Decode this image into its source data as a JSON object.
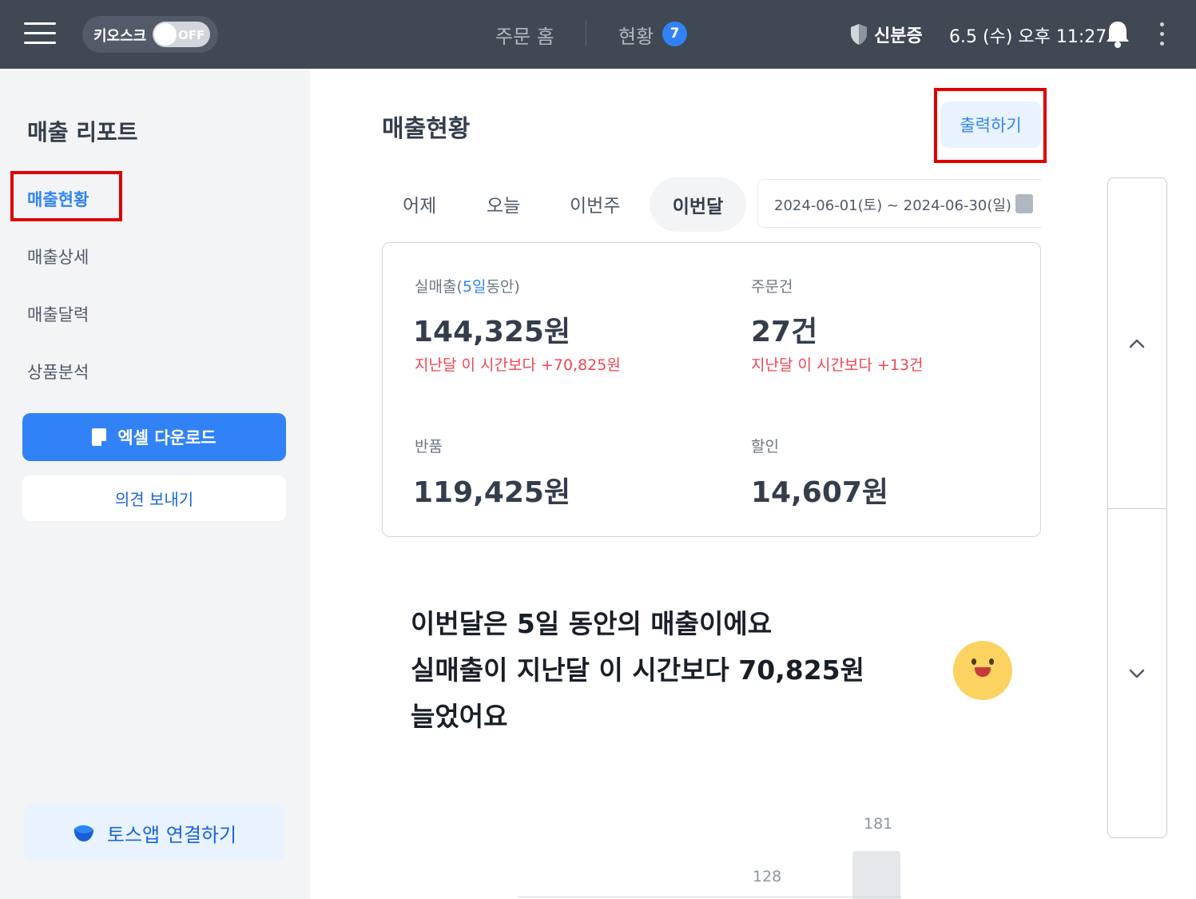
{
  "topbar": {
    "kiosk_label": "키오스크",
    "kiosk_toggle": "OFF",
    "nav_home": "주문 홈",
    "nav_status": "현황",
    "status_badge": "7",
    "id_label": "신분증",
    "datetime": "6.5 (수) 오후 11:27"
  },
  "sidebar": {
    "title": "매출 리포트",
    "items": [
      {
        "label": "매출현황",
        "active": true
      },
      {
        "label": "매출상세",
        "active": false
      },
      {
        "label": "매출달력",
        "active": false
      },
      {
        "label": "상품분석",
        "active": false
      }
    ],
    "excel_button": "엑셀 다운로드",
    "feedback_button": "의견 보내기",
    "toss_button": "토스앱 연결하기"
  },
  "main": {
    "title": "매출현황",
    "print_button": "출력하기",
    "tabs": [
      "어제",
      "오늘",
      "이번주",
      "이번달"
    ],
    "active_tab": "이번달",
    "date_range": "2024-06-01(토) ~ 2024-06-30(일)",
    "stats": {
      "net_sales_label_prefix": "실매출(",
      "net_sales_label_highlight": "5일",
      "net_sales_label_suffix": "동안)",
      "net_sales_value": "144,325원",
      "net_sales_delta": "지난달 이 시간보다 +70,825원",
      "orders_label": "주문건",
      "orders_value": "27건",
      "orders_delta": "지난달 이 시간보다 +13건",
      "returns_label": "반품",
      "returns_value": "119,425원",
      "discount_label": "할인",
      "discount_value": "14,607원"
    },
    "summary": {
      "line1": "이번달은 5일 동안의 매출이에요",
      "line2": "실매출이 지난달 이 시간보다 70,825원",
      "line3": "늘었어요"
    },
    "chart_labels": {
      "left": "128",
      "right": "181"
    }
  },
  "colors": {
    "topbar": "#3f4853",
    "accent": "#3182f6",
    "increase": "#f04452",
    "sidebar_bg": "#f2f4f6"
  }
}
